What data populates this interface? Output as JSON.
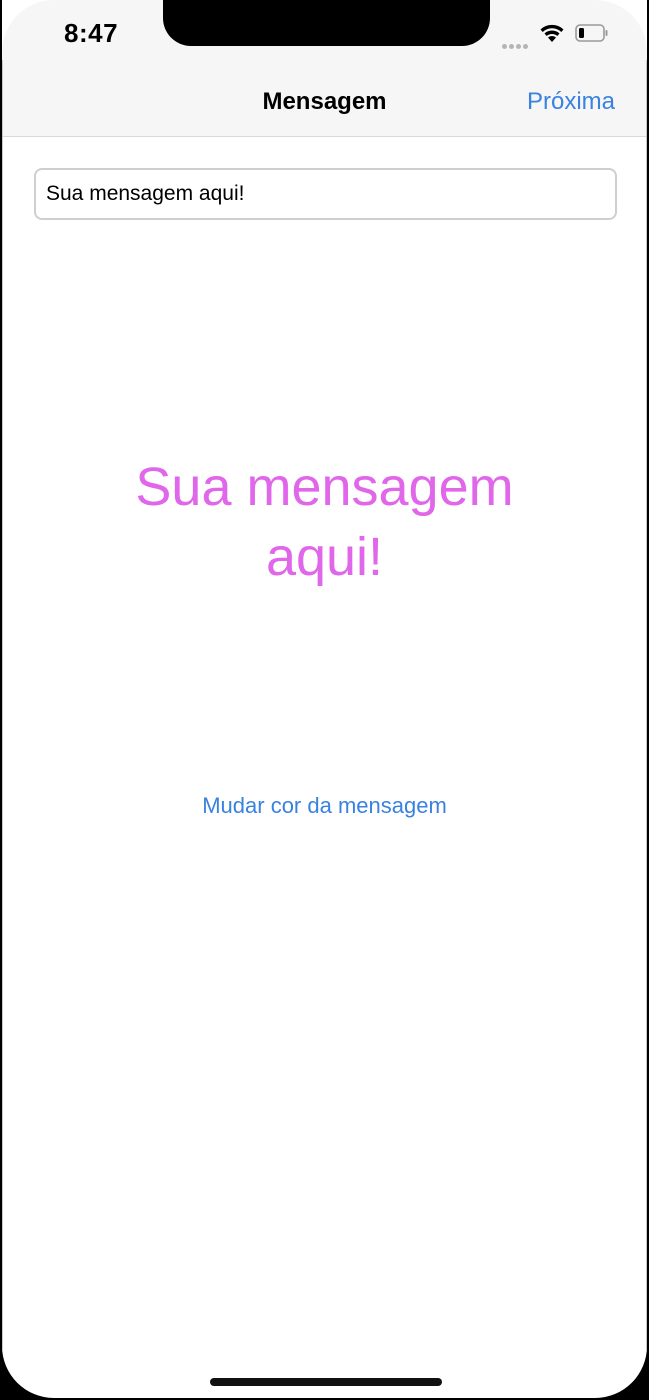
{
  "status_bar": {
    "time": "8:47"
  },
  "nav": {
    "title": "Mensagem",
    "next_label": "Próxima"
  },
  "message_input": {
    "value": "Sua mensagem aqui!",
    "placeholder": ""
  },
  "message_display": {
    "text": "Sua mensagem aqui!",
    "color": "#e066ea"
  },
  "change_color_button": {
    "label": "Mudar cor da mensagem"
  },
  "colors": {
    "accent": "#3a82e0",
    "message": "#e066ea"
  },
  "icons": {
    "signal": "cellular-signal-icon",
    "wifi": "wifi-icon",
    "battery": "battery-icon"
  }
}
